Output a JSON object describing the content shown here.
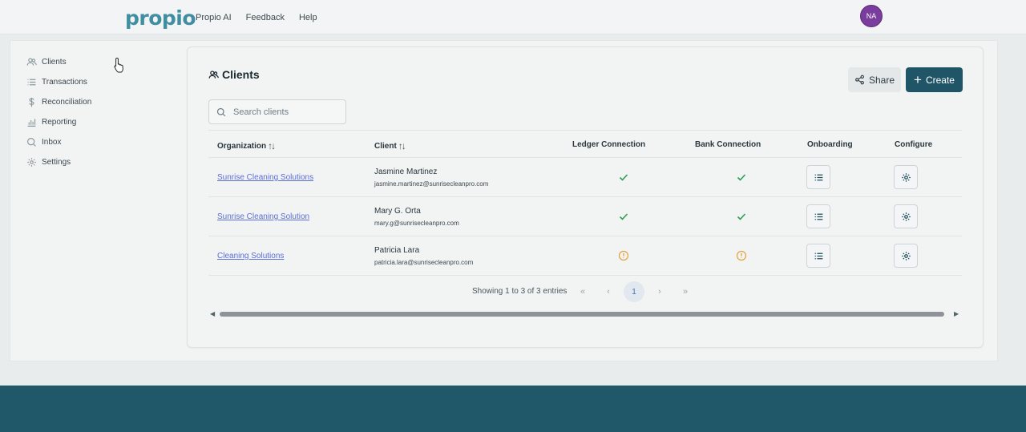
{
  "app": {
    "logo_text": "propio",
    "nav": [
      "Propio AI",
      "Feedback",
      "Help"
    ],
    "avatar_initials": "NA",
    "brand_color": "#3f8ea1",
    "accent_color": "#1f5566"
  },
  "sidebar": {
    "items": [
      {
        "label": "Clients",
        "icon": "users-icon"
      },
      {
        "label": "Transactions",
        "icon": "list-icon"
      },
      {
        "label": "Reconciliation",
        "icon": "dollar-icon"
      },
      {
        "label": "Reporting",
        "icon": "bar-chart-icon"
      },
      {
        "label": "Inbox",
        "icon": "inbox-icon"
      },
      {
        "label": "Settings",
        "icon": "gear-icon"
      }
    ]
  },
  "main": {
    "title": "Clients",
    "share_label": "Share",
    "create_label": "Create",
    "search_placeholder": "Search clients",
    "columns": {
      "organization": "Organization",
      "client": "Client",
      "ledger": "Ledger Connection",
      "bank": "Bank Connection",
      "onboarding": "Onboarding",
      "configure": "Configure"
    },
    "rows": [
      {
        "organization": "Sunrise Cleaning Solutions",
        "name": "Jasmine Martinez",
        "email": "jasmine.martinez@sunrisecleanpro.com",
        "ledger": "connected",
        "bank": "connected"
      },
      {
        "organization": "Sunrise Cleaning Solution",
        "name": "Mary G. Orta",
        "email": "mary.g@sunrisecleanpro.com",
        "ledger": "connected",
        "bank": "connected"
      },
      {
        "organization": "Cleaning Solutions",
        "name": "Patricia Lara",
        "email": "patricia.lara@sunrisecleanpro.com",
        "ledger": "warning",
        "bank": "warning"
      }
    ],
    "pagination": {
      "info": "Showing 1 to 3 of 3 entries",
      "current_page": "1"
    },
    "status_colors": {
      "connected": "#2e9e55",
      "warning": "#e3a23a"
    }
  }
}
